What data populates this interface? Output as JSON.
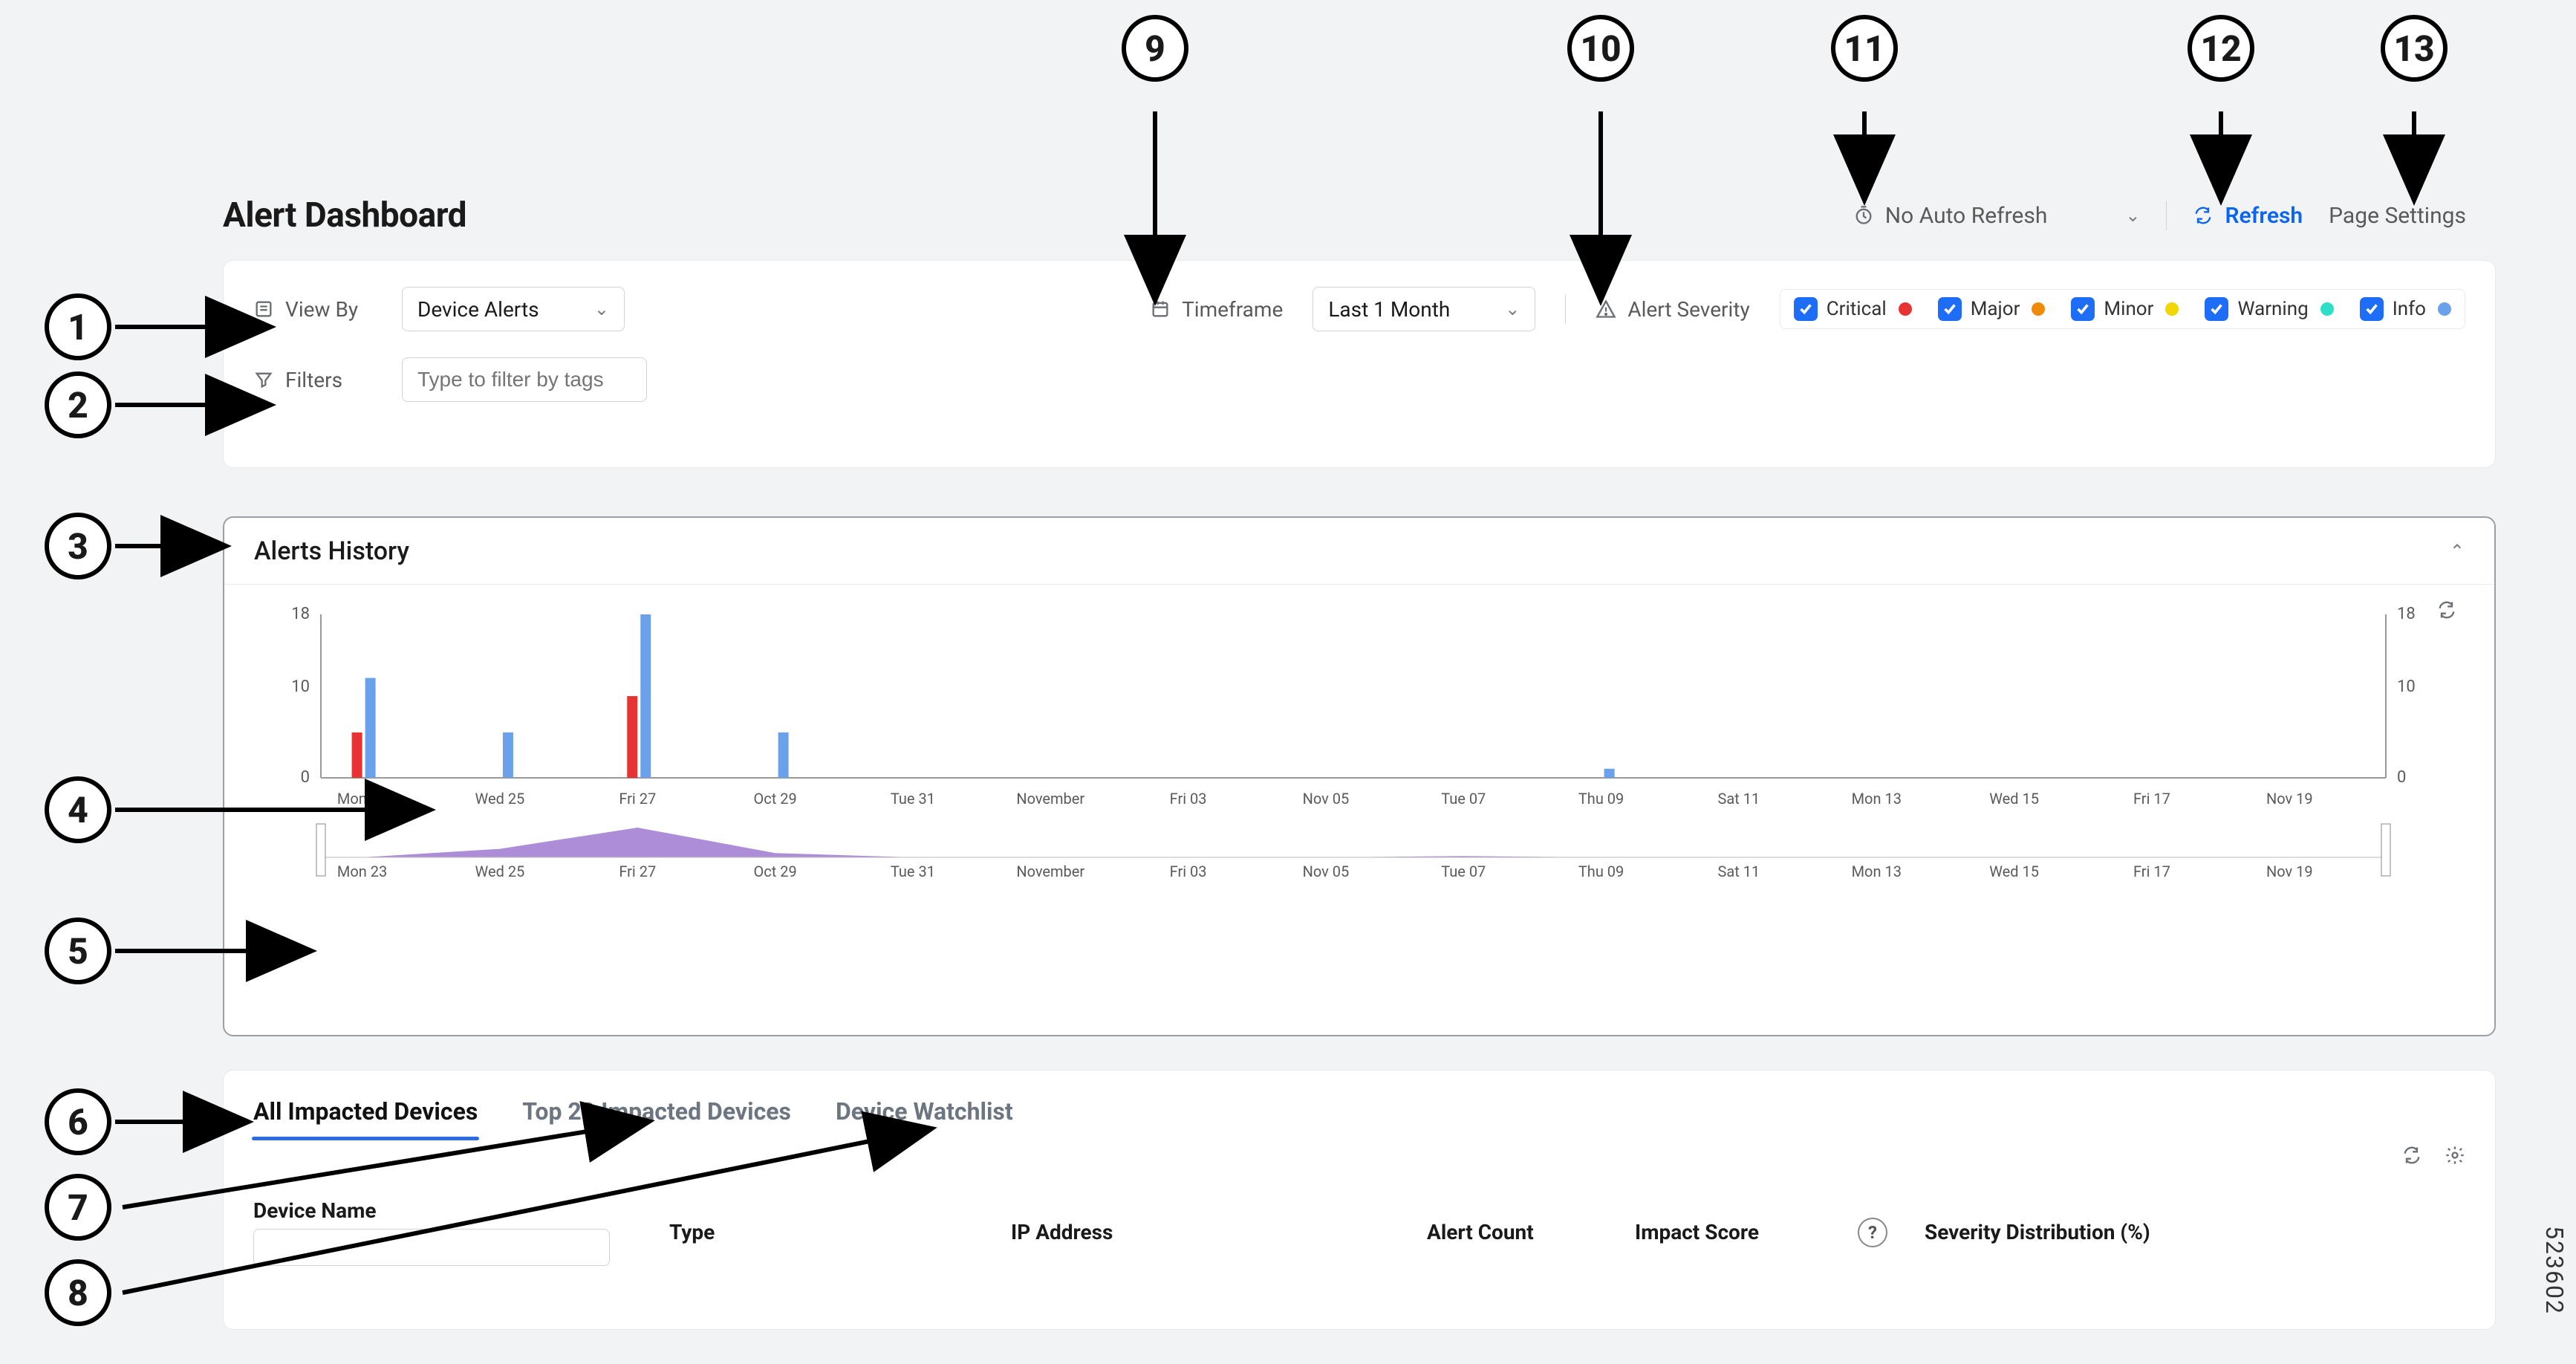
{
  "header": {
    "title": "Alert Dashboard",
    "auto_refresh": "No Auto Refresh",
    "refresh": "Refresh",
    "page_settings": "Page Settings"
  },
  "filters": {
    "view_by_label": "View By",
    "view_by_value": "Device Alerts",
    "filters_label": "Filters",
    "filters_placeholder": "Type to filter by tags",
    "timeframe_label": "Timeframe",
    "timeframe_value": "Last 1 Month",
    "severity_label": "Alert Severity",
    "severities": [
      {
        "key": "critical",
        "label": "Critical",
        "color": "#e73333"
      },
      {
        "key": "major",
        "label": "Major",
        "color": "#f08a0a"
      },
      {
        "key": "minor",
        "label": "Minor",
        "color": "#f2d600"
      },
      {
        "key": "warning",
        "label": "Warning",
        "color": "#2be0c7"
      },
      {
        "key": "info",
        "label": "Info",
        "color": "#6aa1ea"
      }
    ]
  },
  "history": {
    "title": "Alerts History"
  },
  "devices": {
    "tabs": [
      {
        "key": "all",
        "label": "All Impacted Devices",
        "active": true
      },
      {
        "key": "top20",
        "label": "Top 20 Impacted Devices",
        "active": false
      },
      {
        "key": "watch",
        "label": "Device Watchlist",
        "active": false
      }
    ],
    "columns": {
      "device_name": "Device Name",
      "type": "Type",
      "ip": "IP Address",
      "alert_count": "Alert Count",
      "impact_score": "Impact Score",
      "severity_dist": "Severity Distribution (%)"
    }
  },
  "side_code": "523602",
  "callouts": [
    "1",
    "2",
    "3",
    "4",
    "5",
    "6",
    "7",
    "8",
    "9",
    "10",
    "11",
    "12",
    "13"
  ],
  "chart_data": {
    "type": "bar",
    "title": "Alerts History",
    "xlabel": "",
    "ylabel": "",
    "ylim": [
      0,
      18
    ],
    "yticks": [
      0,
      10,
      18
    ],
    "categories": [
      "Mon 23",
      "Wed 25",
      "Fri 27",
      "Oct 29",
      "Tue 31",
      "November",
      "Fri 03",
      "Nov 05",
      "Tue 07",
      "Thu 09",
      "Sat 11",
      "Mon 13",
      "Wed 15",
      "Fri 17",
      "Nov 19"
    ],
    "series": [
      {
        "name": "Critical",
        "color": "#e73333",
        "values": [
          5,
          0,
          9,
          0,
          0,
          0,
          0,
          0,
          0,
          0,
          0,
          0,
          0,
          0,
          0
        ]
      },
      {
        "name": "Info",
        "color": "#6aa1ea",
        "values": [
          11,
          5,
          18,
          5,
          0,
          0,
          0,
          0,
          0,
          1,
          0,
          0,
          0,
          0,
          0
        ]
      }
    ],
    "overview_series": {
      "name": "overview",
      "color": "#8a5cc7",
      "values": [
        0,
        2,
        7,
        1,
        0,
        0,
        0,
        0,
        0.3,
        0,
        0,
        0,
        0,
        0,
        0
      ]
    }
  }
}
